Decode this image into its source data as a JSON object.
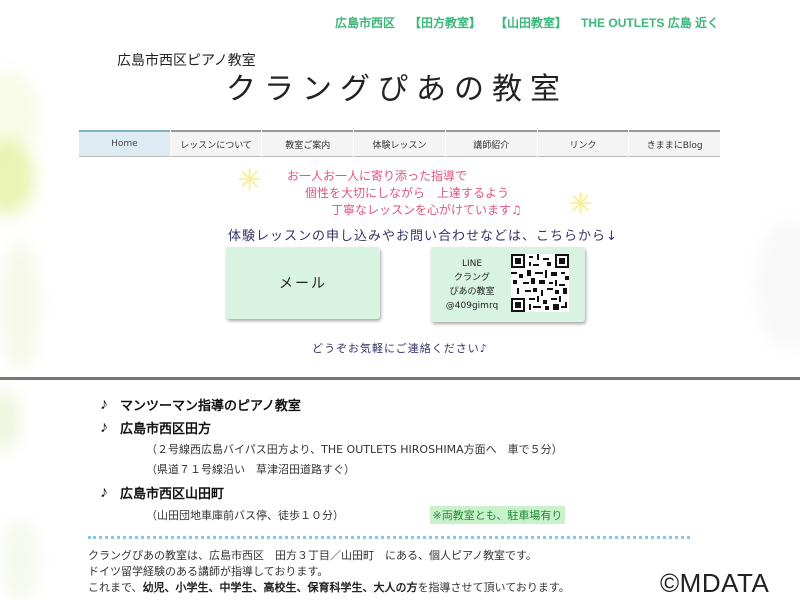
{
  "top_links": [
    "広島市西区",
    "【田方教室】",
    "【山田教室】",
    "THE OUTLETS 広島 近く"
  ],
  "site": {
    "subtitle": "広島市西区ピアノ教室",
    "title": "クラングぴあの教室"
  },
  "nav": [
    {
      "label": "Home",
      "active": true
    },
    {
      "label": "レッスンについて",
      "active": false
    },
    {
      "label": "教室ご案内",
      "active": false
    },
    {
      "label": "体験レッスン",
      "active": false
    },
    {
      "label": "講師紹介",
      "active": false
    },
    {
      "label": "リンク",
      "active": false
    },
    {
      "label": "きままにBlog",
      "active": false
    }
  ],
  "intro": {
    "line1": "お一人お一人に寄り添った指導で",
    "line2": "個性を大切にしながら　上達するよう",
    "line3": "丁寧なレッスンを心がけています♫"
  },
  "contact": {
    "lead": "体験レッスンの申し込みやお問い合わせなどは、こちらから↓",
    "mail_label": "メール",
    "line_label": "LINE",
    "line_name1": "クラング",
    "line_name2": "ぴあの教室",
    "line_id": "@409gimrq",
    "casual": "どうぞお気軽にご連絡ください♪"
  },
  "features": {
    "item1": "マンツーマン指導のピアノ教室",
    "item2": "広島市西区田方",
    "item2_sub1": "（２号線西広島バイパス田方より、THE OUTLETS HIROSHIMA方面へ　車で５分）",
    "item2_sub2": "（県道７１号線沿い　草津沼田道路すぐ）",
    "item3": "広島市西区山田町",
    "item3_sub": "（山田団地車庫前バス停、徒歩１０分）",
    "parking": "※両教室とも、駐車場有り"
  },
  "about": {
    "line1": "クラングぴあの教室は、広島市西区　田方３丁目／山田町　にある、個人ピアノ教室です。",
    "line2": "ドイツ留学経験のある講師が指導しております。",
    "line3_pre": "これまで、",
    "line3_bold": "幼児、小学生、中学生、高校生、保育科学生、大人の方",
    "line3_post": "を指導させて頂いております。"
  },
  "watermark": "©MDATA",
  "colors": {
    "link_green": "#3cb67a",
    "intro_pink": "#e0567d",
    "button_mint": "#d9f3e3",
    "nav_active": "#dcecf2",
    "dotted_rule": "#86c8e8"
  }
}
